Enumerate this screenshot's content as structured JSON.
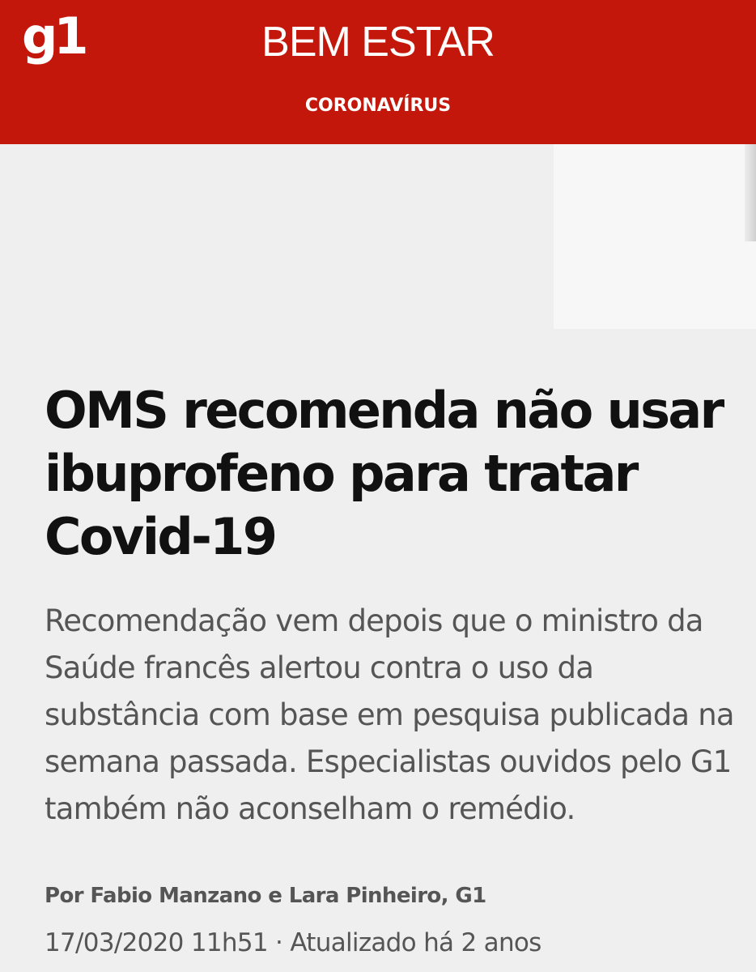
{
  "header": {
    "logo_text": "g1",
    "section_title": "BEM ESTAR",
    "subsection": "CORONAVÍRUS",
    "background_color": "#c4170c"
  },
  "article": {
    "headline": "OMS recomenda não usar ibuprofeno para tratar Covid-19",
    "subtitle": "Recomendação vem depois que o ministro da Saúde francês alertou contra o uso da substância com base em pesquisa publicada na semana passada. Especialistas ouvidos pelo G1 também não aconselham o remédio.",
    "byline": "Por Fabio Manzano e Lara Pinheiro, G1",
    "dateline": "17/03/2020 11h51 · Atualizado há 2 anos"
  }
}
